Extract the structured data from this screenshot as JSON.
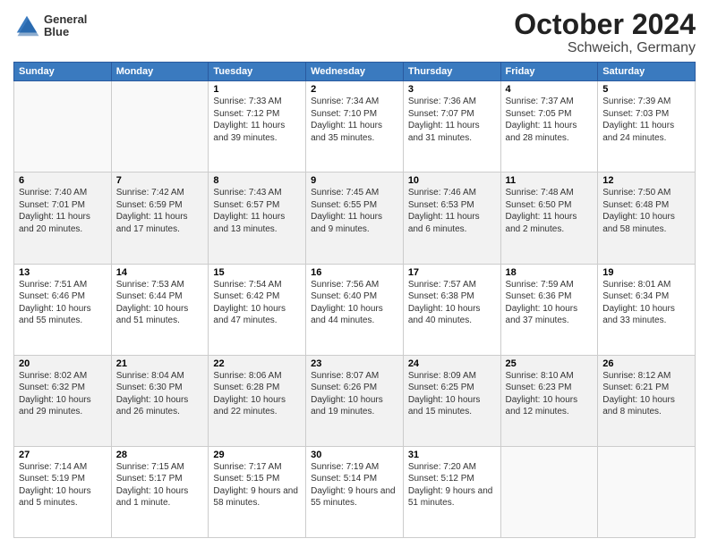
{
  "header": {
    "logo_line1": "General",
    "logo_line2": "Blue",
    "month": "October 2024",
    "location": "Schweich, Germany"
  },
  "days_of_week": [
    "Sunday",
    "Monday",
    "Tuesday",
    "Wednesday",
    "Thursday",
    "Friday",
    "Saturday"
  ],
  "weeks": [
    [
      {
        "day": "",
        "sunrise": "",
        "sunset": "",
        "daylight": ""
      },
      {
        "day": "",
        "sunrise": "",
        "sunset": "",
        "daylight": ""
      },
      {
        "day": "1",
        "sunrise": "Sunrise: 7:33 AM",
        "sunset": "Sunset: 7:12 PM",
        "daylight": "Daylight: 11 hours and 39 minutes."
      },
      {
        "day": "2",
        "sunrise": "Sunrise: 7:34 AM",
        "sunset": "Sunset: 7:10 PM",
        "daylight": "Daylight: 11 hours and 35 minutes."
      },
      {
        "day": "3",
        "sunrise": "Sunrise: 7:36 AM",
        "sunset": "Sunset: 7:07 PM",
        "daylight": "Daylight: 11 hours and 31 minutes."
      },
      {
        "day": "4",
        "sunrise": "Sunrise: 7:37 AM",
        "sunset": "Sunset: 7:05 PM",
        "daylight": "Daylight: 11 hours and 28 minutes."
      },
      {
        "day": "5",
        "sunrise": "Sunrise: 7:39 AM",
        "sunset": "Sunset: 7:03 PM",
        "daylight": "Daylight: 11 hours and 24 minutes."
      }
    ],
    [
      {
        "day": "6",
        "sunrise": "Sunrise: 7:40 AM",
        "sunset": "Sunset: 7:01 PM",
        "daylight": "Daylight: 11 hours and 20 minutes."
      },
      {
        "day": "7",
        "sunrise": "Sunrise: 7:42 AM",
        "sunset": "Sunset: 6:59 PM",
        "daylight": "Daylight: 11 hours and 17 minutes."
      },
      {
        "day": "8",
        "sunrise": "Sunrise: 7:43 AM",
        "sunset": "Sunset: 6:57 PM",
        "daylight": "Daylight: 11 hours and 13 minutes."
      },
      {
        "day": "9",
        "sunrise": "Sunrise: 7:45 AM",
        "sunset": "Sunset: 6:55 PM",
        "daylight": "Daylight: 11 hours and 9 minutes."
      },
      {
        "day": "10",
        "sunrise": "Sunrise: 7:46 AM",
        "sunset": "Sunset: 6:53 PM",
        "daylight": "Daylight: 11 hours and 6 minutes."
      },
      {
        "day": "11",
        "sunrise": "Sunrise: 7:48 AM",
        "sunset": "Sunset: 6:50 PM",
        "daylight": "Daylight: 11 hours and 2 minutes."
      },
      {
        "day": "12",
        "sunrise": "Sunrise: 7:50 AM",
        "sunset": "Sunset: 6:48 PM",
        "daylight": "Daylight: 10 hours and 58 minutes."
      }
    ],
    [
      {
        "day": "13",
        "sunrise": "Sunrise: 7:51 AM",
        "sunset": "Sunset: 6:46 PM",
        "daylight": "Daylight: 10 hours and 55 minutes."
      },
      {
        "day": "14",
        "sunrise": "Sunrise: 7:53 AM",
        "sunset": "Sunset: 6:44 PM",
        "daylight": "Daylight: 10 hours and 51 minutes."
      },
      {
        "day": "15",
        "sunrise": "Sunrise: 7:54 AM",
        "sunset": "Sunset: 6:42 PM",
        "daylight": "Daylight: 10 hours and 47 minutes."
      },
      {
        "day": "16",
        "sunrise": "Sunrise: 7:56 AM",
        "sunset": "Sunset: 6:40 PM",
        "daylight": "Daylight: 10 hours and 44 minutes."
      },
      {
        "day": "17",
        "sunrise": "Sunrise: 7:57 AM",
        "sunset": "Sunset: 6:38 PM",
        "daylight": "Daylight: 10 hours and 40 minutes."
      },
      {
        "day": "18",
        "sunrise": "Sunrise: 7:59 AM",
        "sunset": "Sunset: 6:36 PM",
        "daylight": "Daylight: 10 hours and 37 minutes."
      },
      {
        "day": "19",
        "sunrise": "Sunrise: 8:01 AM",
        "sunset": "Sunset: 6:34 PM",
        "daylight": "Daylight: 10 hours and 33 minutes."
      }
    ],
    [
      {
        "day": "20",
        "sunrise": "Sunrise: 8:02 AM",
        "sunset": "Sunset: 6:32 PM",
        "daylight": "Daylight: 10 hours and 29 minutes."
      },
      {
        "day": "21",
        "sunrise": "Sunrise: 8:04 AM",
        "sunset": "Sunset: 6:30 PM",
        "daylight": "Daylight: 10 hours and 26 minutes."
      },
      {
        "day": "22",
        "sunrise": "Sunrise: 8:06 AM",
        "sunset": "Sunset: 6:28 PM",
        "daylight": "Daylight: 10 hours and 22 minutes."
      },
      {
        "day": "23",
        "sunrise": "Sunrise: 8:07 AM",
        "sunset": "Sunset: 6:26 PM",
        "daylight": "Daylight: 10 hours and 19 minutes."
      },
      {
        "day": "24",
        "sunrise": "Sunrise: 8:09 AM",
        "sunset": "Sunset: 6:25 PM",
        "daylight": "Daylight: 10 hours and 15 minutes."
      },
      {
        "day": "25",
        "sunrise": "Sunrise: 8:10 AM",
        "sunset": "Sunset: 6:23 PM",
        "daylight": "Daylight: 10 hours and 12 minutes."
      },
      {
        "day": "26",
        "sunrise": "Sunrise: 8:12 AM",
        "sunset": "Sunset: 6:21 PM",
        "daylight": "Daylight: 10 hours and 8 minutes."
      }
    ],
    [
      {
        "day": "27",
        "sunrise": "Sunrise: 7:14 AM",
        "sunset": "Sunset: 5:19 PM",
        "daylight": "Daylight: 10 hours and 5 minutes."
      },
      {
        "day": "28",
        "sunrise": "Sunrise: 7:15 AM",
        "sunset": "Sunset: 5:17 PM",
        "daylight": "Daylight: 10 hours and 1 minute."
      },
      {
        "day": "29",
        "sunrise": "Sunrise: 7:17 AM",
        "sunset": "Sunset: 5:15 PM",
        "daylight": "Daylight: 9 hours and 58 minutes."
      },
      {
        "day": "30",
        "sunrise": "Sunrise: 7:19 AM",
        "sunset": "Sunset: 5:14 PM",
        "daylight": "Daylight: 9 hours and 55 minutes."
      },
      {
        "day": "31",
        "sunrise": "Sunrise: 7:20 AM",
        "sunset": "Sunset: 5:12 PM",
        "daylight": "Daylight: 9 hours and 51 minutes."
      },
      {
        "day": "",
        "sunrise": "",
        "sunset": "",
        "daylight": ""
      },
      {
        "day": "",
        "sunrise": "",
        "sunset": "",
        "daylight": ""
      }
    ]
  ]
}
